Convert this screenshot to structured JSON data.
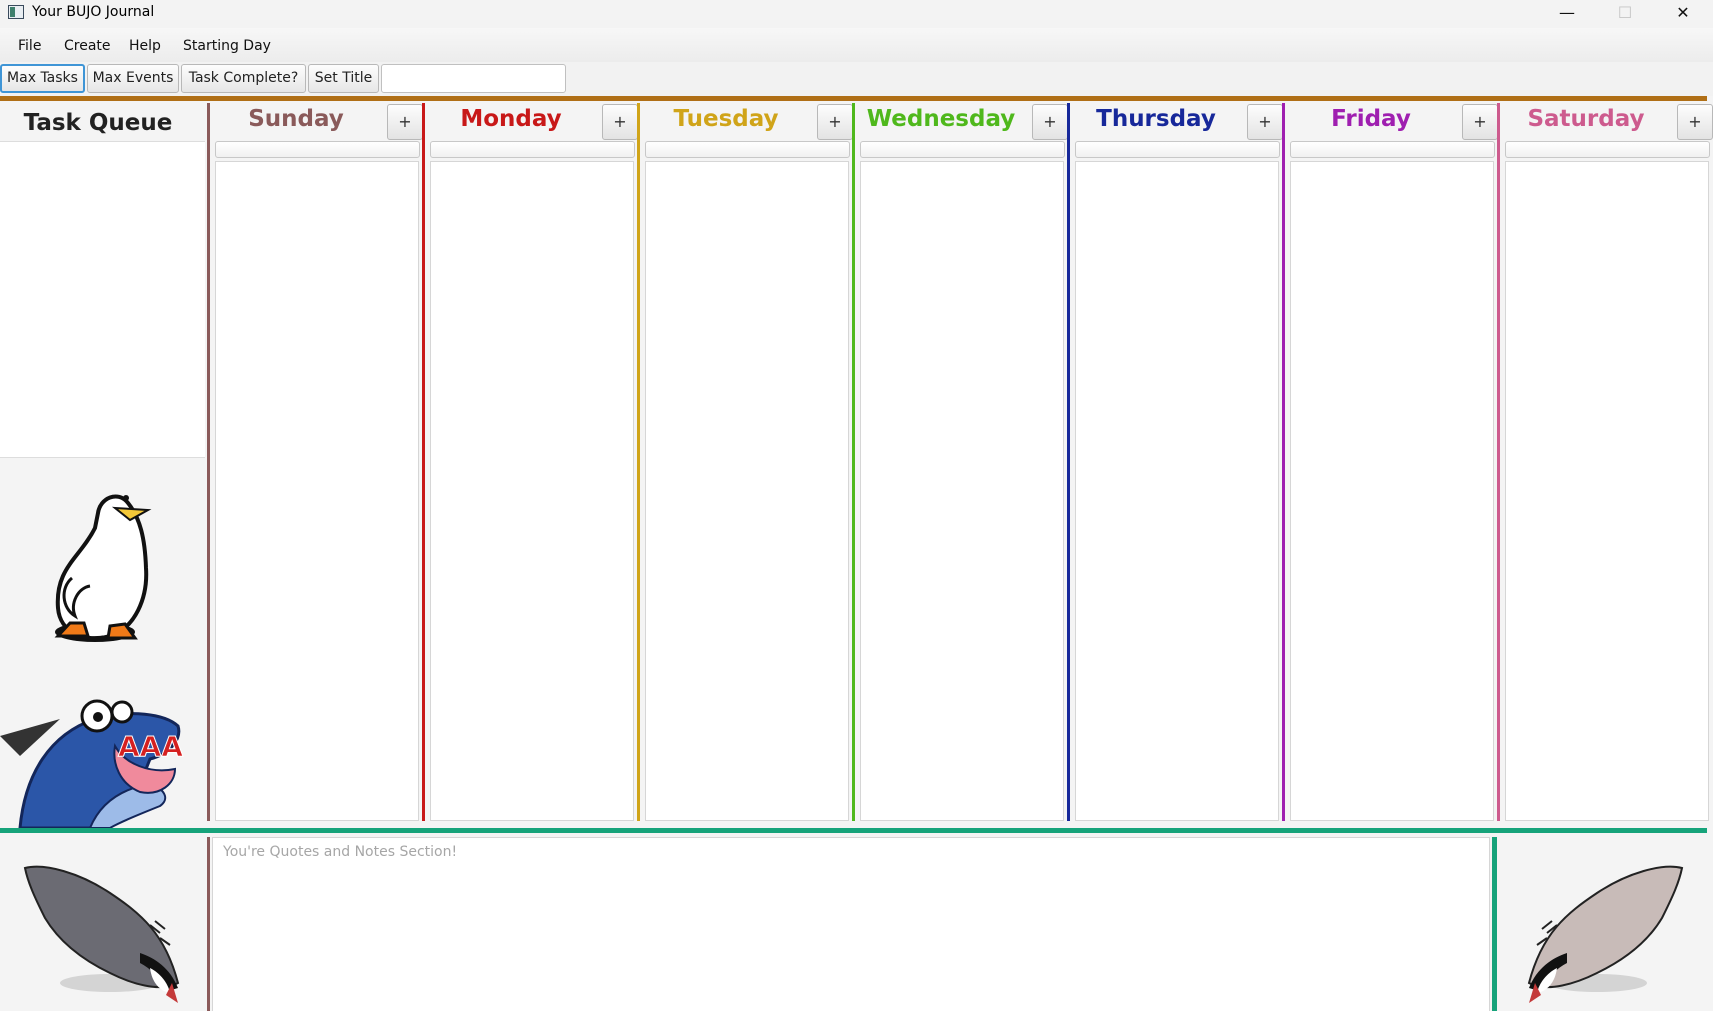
{
  "window": {
    "title": "Your BUJO Journal",
    "minimize_glyph": "—",
    "maximize_glyph": "☐",
    "close_glyph": "✕"
  },
  "menu": [
    "File",
    "Create",
    "Help",
    "Starting Day"
  ],
  "toolbar": {
    "max_tasks": "Max Tasks",
    "max_events": "Max Events",
    "task_complete": "Task Complete?",
    "set_title": "Set Title",
    "title_value": ""
  },
  "task_queue": {
    "label": "Task Queue"
  },
  "days": [
    {
      "name": "Sunday",
      "color": "#8a5a5a"
    },
    {
      "name": "Monday",
      "color": "#c81818"
    },
    {
      "name": "Tuesday",
      "color": "#d0a419"
    },
    {
      "name": "Wednesday",
      "color": "#4fb81c"
    },
    {
      "name": "Thursday",
      "color": "#17289a"
    },
    {
      "name": "Friday",
      "color": "#9f1fb0"
    },
    {
      "name": "Saturday",
      "color": "#cd5b8e"
    }
  ],
  "add_label": "+",
  "notes": {
    "placeholder": "You're Quotes and Notes Section!"
  },
  "sticker_text": "AAA",
  "colors": {
    "top_rule": "#b06f16",
    "bottom_rule": "#16a37a",
    "accent_focus": "#3f95d6"
  }
}
